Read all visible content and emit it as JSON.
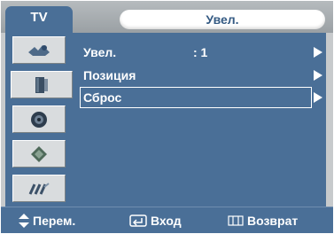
{
  "header": {
    "source_tab": "TV",
    "title": "Увел."
  },
  "sidebar": {
    "items": [
      {
        "icon": "picture-icon",
        "active": false
      },
      {
        "icon": "speaker-icon",
        "active": true
      },
      {
        "icon": "channel-icon",
        "active": false
      },
      {
        "icon": "setup-chip-icon",
        "active": false
      },
      {
        "icon": "function-icon",
        "active": false
      }
    ]
  },
  "menu": {
    "items": [
      {
        "label": "Увел.",
        "value": ": 1",
        "selected": false
      },
      {
        "label": "Позиция",
        "value": "",
        "selected": false
      },
      {
        "label": "Сброс",
        "value": "",
        "selected": true
      }
    ]
  },
  "footer": {
    "move": "Перем.",
    "enter": "Вход",
    "return": "Возврат"
  },
  "colors": {
    "panel_blue": "#4a6f97",
    "frame_gray": "#c7cacc",
    "text": "#ffffff"
  }
}
